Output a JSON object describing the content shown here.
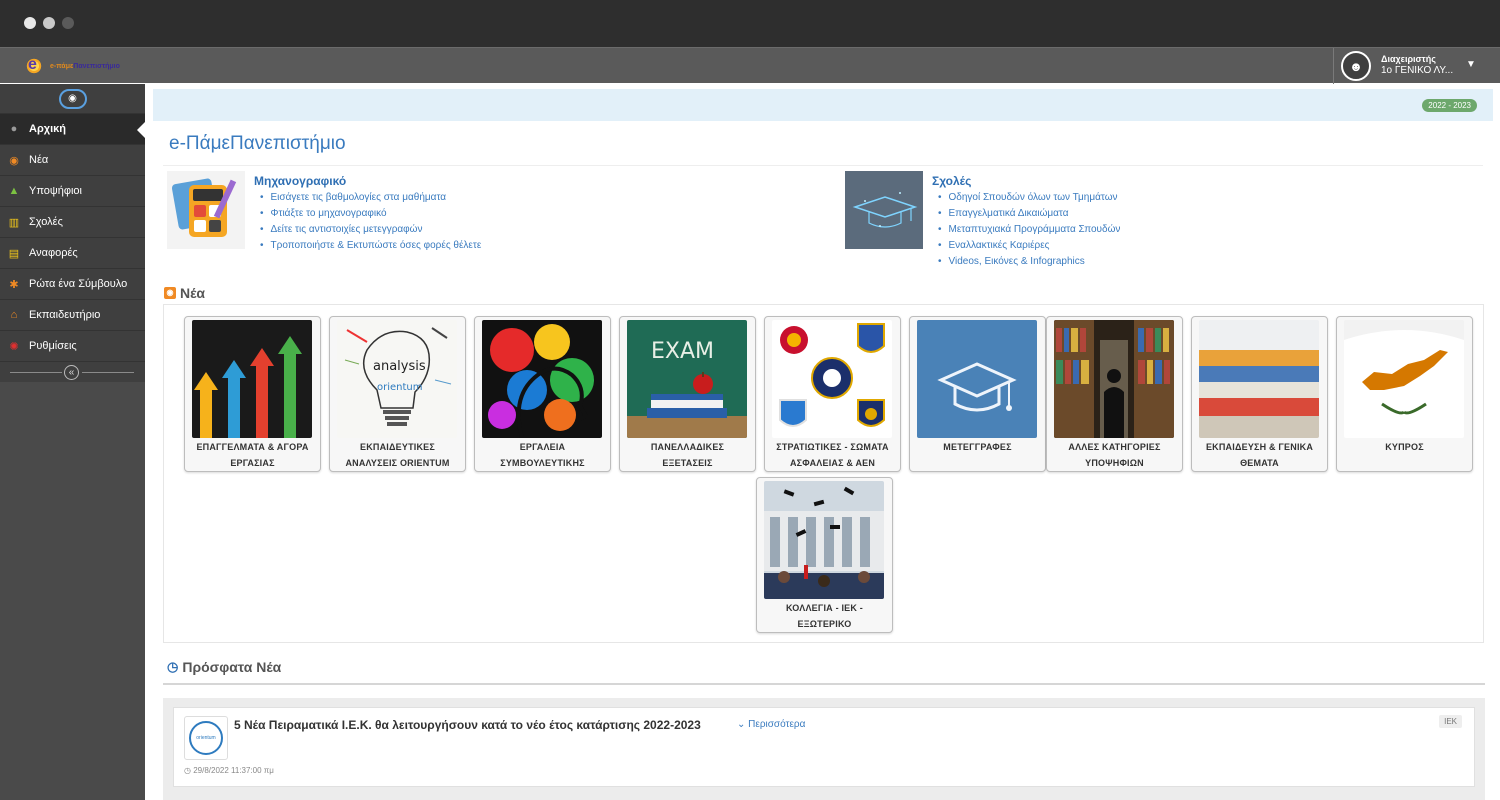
{
  "header": {
    "logo_text_a": "e-πάμε",
    "logo_text_b": "Πανεπιστήμιο",
    "user_role": "Διαχειριστής",
    "user_school": "1ο ΓΕΝΙΚΟ ΛΥ..."
  },
  "sidebar": {
    "items": [
      {
        "label": "Αρχική",
        "icon": "circle-icon",
        "color": "#9a9a9a"
      },
      {
        "label": "Νέα",
        "icon": "rss-icon",
        "color": "#f08a24"
      },
      {
        "label": "Υποψήφιοι",
        "icon": "graduation-cap-icon",
        "color": "#7cc242"
      },
      {
        "label": "Σχολές",
        "icon": "institution-icon",
        "color": "#f2c81a"
      },
      {
        "label": "Αναφορές",
        "icon": "printer-icon",
        "color": "#f2c81a"
      },
      {
        "label": "Ρώτα ένα Σύμβουλο",
        "icon": "asterisk-icon",
        "color": "#f08a24"
      },
      {
        "label": "Εκπαιδευτήριο",
        "icon": "home-icon",
        "color": "#f08a24"
      },
      {
        "label": "Ρυθμίσεις",
        "icon": "gear-icon",
        "color": "#e03030"
      }
    ]
  },
  "main": {
    "year_badge": "2022 - 2023",
    "title": "e-ΠάμεΠανεπιστήμιο",
    "features": [
      {
        "title": "Μηχανογραφικό",
        "items": [
          "Εισάγετε τις βαθμολογίες στα μαθήματα",
          "Φτιάξτε το μηχανογραφικό",
          "Δείτε τις αντιστοιχίες μετεγγραφών",
          "Τροποποιήστε & Εκτυπώστε όσες φορές θέλετε"
        ]
      },
      {
        "title": "Σχολές",
        "items": [
          "Οδηγοί Σπουδών όλων των Τμημάτων",
          "Επαγγελματικά Δικαιώματα",
          "Μεταπτυχιακά Προγράμματα Σπουδών",
          "Εναλλακτικές Καριέρες",
          "Videos, Εικόνες & Infographics"
        ]
      }
    ],
    "news_heading": "Νέα",
    "news_cards": [
      {
        "line1": "ΕΠΑΓΓΕΛΜΑΤΑ & ΑΓΟΡΑ",
        "line2": "ΕΡΓΑΣΙΑΣ"
      },
      {
        "line1": "ΕΚΠΑΙΔΕΥΤΙΚΕΣ",
        "line2": "ΑΝΑΛΥΣΕΙΣ ORIENTUM"
      },
      {
        "line1": "ΕΡΓΑΛΕΙΑ",
        "line2": "ΣΥΜΒΟΥΛΕΥΤΙΚΗΣ"
      },
      {
        "line1": "ΠΑΝΕΛΛΑΔΙΚΕΣ",
        "line2": "ΕΞΕΤΑΣΕΙΣ"
      },
      {
        "line1": "ΣΤΡΑΤΙΩΤΙΚΕΣ - ΣΩΜΑΤΑ",
        "line2": "ΑΣΦΑΛΕΙΑΣ & ΑΕΝ"
      },
      {
        "line1": "ΜΕΤΕΓΓΡΑΦΕΣ",
        "line2": ""
      },
      {
        "line1": "ΑΛΛΕΣ ΚΑΤΗΓΟΡΙΕΣ",
        "line2": "ΥΠΟΨΗΦΙΩΝ"
      },
      {
        "line1": "ΕΚΠΑΙΔΕΥΣΗ & ΓΕΝΙΚΑ",
        "line2": "ΘΕΜΑΤΑ"
      },
      {
        "line1": "ΚΥΠΡΟΣ",
        "line2": ""
      },
      {
        "line1": "ΚΟΛΛΕΓΙΑ - ΙΕΚ -",
        "line2": "ΕΞΩΤΕΡΙΚΟ"
      }
    ],
    "card_art": {
      "exam_text": "EXAM",
      "analysis_text": "analysis",
      "orientum_text": "orientum"
    },
    "recent_heading": "Πρόσφατα Νέα",
    "recent_items": [
      {
        "title": "5 Νέα Πειραματικά Ι.Ε.Κ. θα λειτουργήσουν κατά το νέο έτος κατάρτισης 2022-2023",
        "more": "Περισσότερα",
        "tag": "ΙΕΚ",
        "date": "29/8/2022 11:37:00 πμ",
        "thumb_text": "orientum"
      }
    ]
  },
  "colors": {
    "accent": "#3a7bbf",
    "sidebar_bg": "#3f3f3f",
    "badge_green": "#6da86c"
  }
}
